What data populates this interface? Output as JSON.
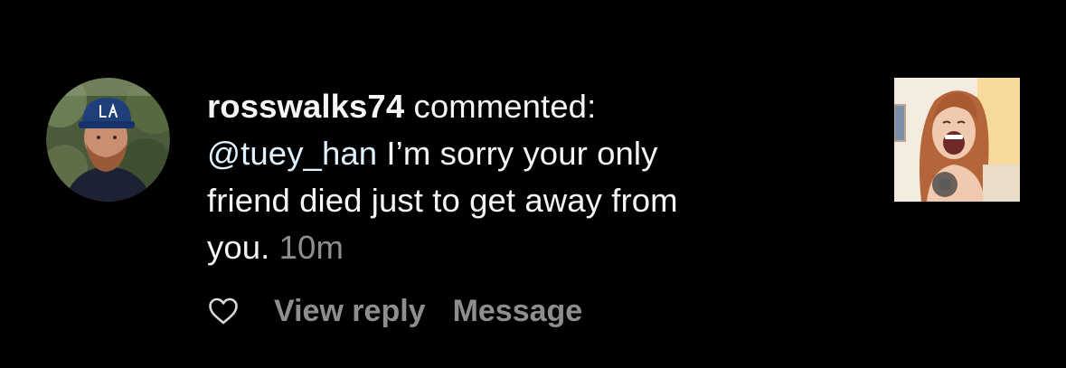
{
  "comment": {
    "username": "rosswalks74",
    "action": "commented:",
    "mention": "@tuey_han",
    "text_line_1": "I’m sorry your only",
    "text_line_2": "friend died just to get away from",
    "text_line_3": "you.",
    "timestamp": "10m"
  },
  "actions": {
    "like_icon": "heart-outline-icon",
    "view_reply": "View reply",
    "message": "Message"
  },
  "avatar": {
    "cap_logo": "LA"
  },
  "colors": {
    "background": "#000000",
    "primary_text": "#f5f5f5",
    "mention_text": "#e0f1ff",
    "secondary_text": "#8e8e8e"
  }
}
